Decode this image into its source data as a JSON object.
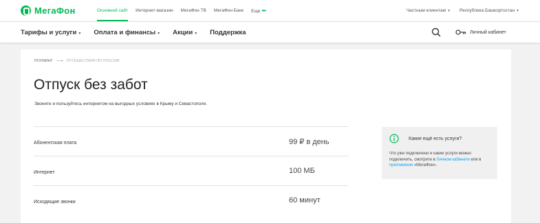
{
  "brand": {
    "name": "МегаФон",
    "color": "#00b956"
  },
  "top_nav": {
    "links": [
      {
        "label": "Основной сайт",
        "active": true
      },
      {
        "label": "Интернет-магазин",
        "active": false
      },
      {
        "label": "МегаФон ТВ",
        "active": false
      },
      {
        "label": "МегаФон Банк",
        "active": false
      }
    ],
    "more_label": "Еще",
    "more_dots": "•••",
    "client_type": "Частным клиентам",
    "region": "Республика Башкортостан"
  },
  "main_nav": {
    "items": [
      {
        "label": "Тарифы и услуги",
        "dropdown": true
      },
      {
        "label": "Оплата и финансы",
        "dropdown": true
      },
      {
        "label": "Акции",
        "dropdown": true
      },
      {
        "label": "Поддержка",
        "dropdown": false
      }
    ],
    "search_icon": "search-icon",
    "cabinet_label": "Личный кабинет",
    "cabinet_icon": "key-icon"
  },
  "breadcrumb": {
    "parent": "Роуминг",
    "current": "Путешествия по России"
  },
  "page": {
    "title": "Отпуск без забот",
    "subtitle": "Звоните и пользуйтесь интернетом на выгодных условиях в Крыму и Севастополе."
  },
  "features": [
    {
      "name": "Абонентская плата",
      "value": "99 ₽ в день"
    },
    {
      "name": "Интернет",
      "value": "100 МБ"
    },
    {
      "name": "Исходящие звонки",
      "value": "60 минут"
    }
  ],
  "info_box": {
    "icon": "info-icon",
    "title": "Какие ещё есть услуги?",
    "text_1": "Что уже подключено и какие услуги можно подключить, смотрите в ",
    "link_1": "Личном кабинете",
    "text_2": " или в ",
    "link_2": "приложении",
    "text_3": " «МегаФон».",
    "link_color": "#00a3ff"
  }
}
